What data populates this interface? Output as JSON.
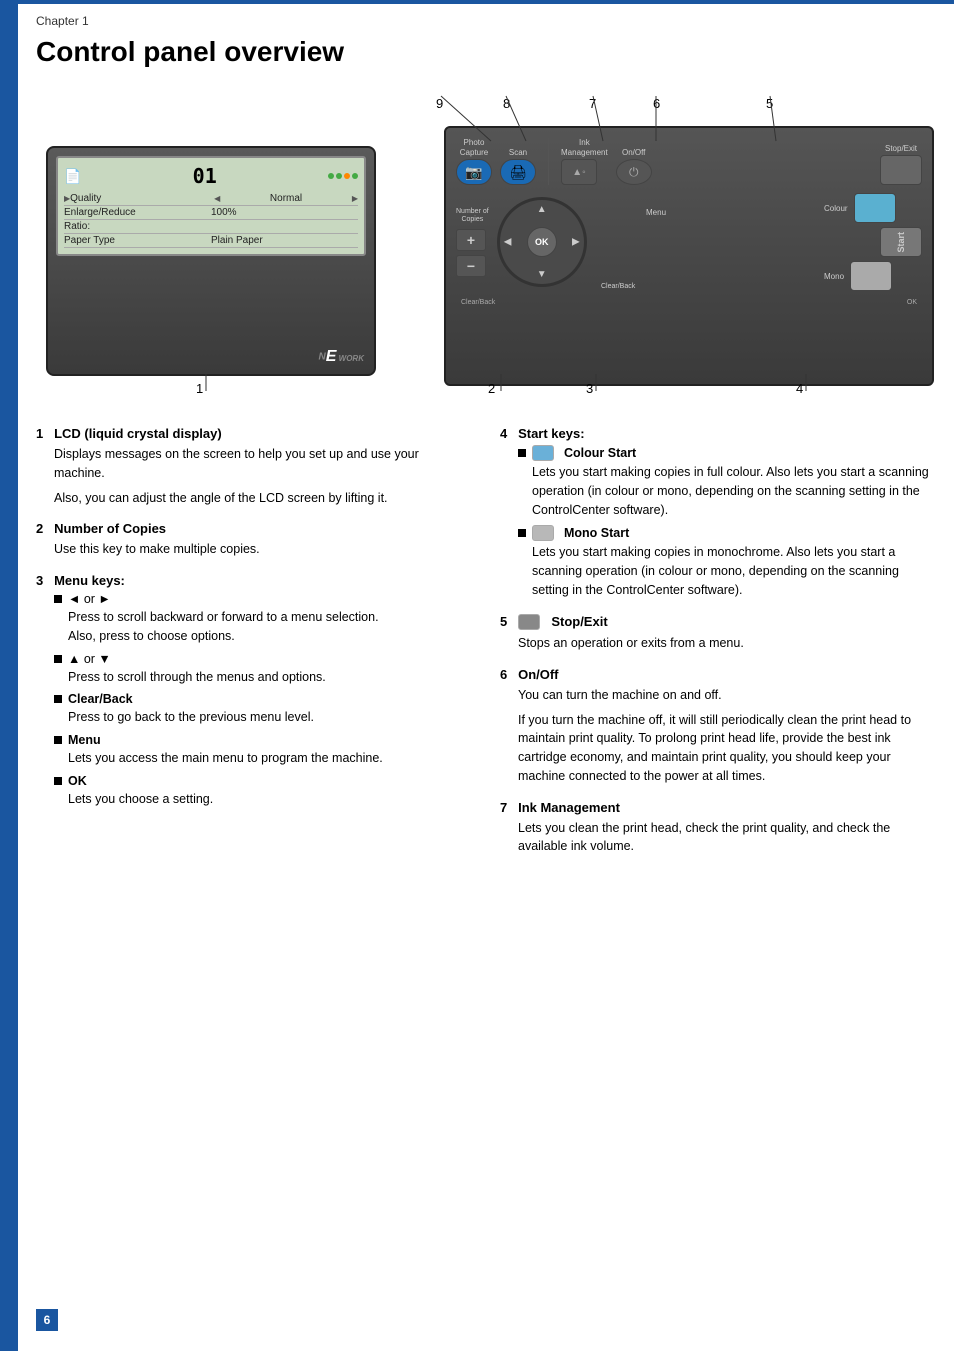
{
  "page": {
    "chapter_label": "Chapter 1",
    "title": "Control panel overview",
    "page_number": "6"
  },
  "diagram": {
    "number_labels": [
      {
        "id": "num9",
        "text": "9"
      },
      {
        "id": "num8",
        "text": "8"
      },
      {
        "id": "num7",
        "text": "7"
      },
      {
        "id": "num6",
        "text": "6"
      },
      {
        "id": "num5",
        "text": "5"
      },
      {
        "id": "num1",
        "text": "1"
      },
      {
        "id": "num2",
        "text": "2"
      },
      {
        "id": "num3",
        "text": "3"
      },
      {
        "id": "num4",
        "text": "4"
      }
    ],
    "lcd": {
      "number": "01",
      "rows": [
        {
          "label": "Quality",
          "value": "Normal",
          "has_arrows": true
        },
        {
          "label": "Enlarge/Reduce",
          "value": "100%"
        },
        {
          "label": "Ratio:",
          "value": ""
        },
        {
          "label": "Paper Type",
          "value": "Plain Paper"
        }
      ],
      "network_text": "NE WORK"
    },
    "ctrl_buttons": [
      {
        "label": "Photo\nCapture",
        "type": "dark"
      },
      {
        "label": "Scan",
        "type": "dark"
      },
      {
        "label": "Ink\nManagement",
        "type": "dark"
      },
      {
        "label": "On/Off",
        "type": "dark"
      }
    ]
  },
  "items": [
    {
      "number": "1",
      "title": "LCD (liquid crystal display)",
      "paragraphs": [
        "Displays messages on the screen to help you set up and use your machine.",
        "Also, you can adjust the angle of the LCD screen by lifting it."
      ],
      "sub_items": []
    },
    {
      "number": "2",
      "title": "Number of Copies",
      "paragraphs": [
        "Use this key to make multiple copies."
      ],
      "sub_items": []
    },
    {
      "number": "3",
      "title": "Menu keys:",
      "paragraphs": [],
      "sub_items": [
        {
          "label": "◄ or ►",
          "texts": [
            "Press to scroll backward or forward to a menu selection.",
            "Also, press to choose options."
          ]
        },
        {
          "label": "▲ or ▼",
          "texts": [
            "Press to scroll through the menus and options."
          ]
        },
        {
          "label": "Clear/Back",
          "texts": [
            "Press to go back to the previous menu level."
          ]
        },
        {
          "label": "Menu",
          "texts": [
            "Lets you access the main menu to program the machine."
          ]
        },
        {
          "label": "OK",
          "texts": [
            "Lets you choose a setting."
          ]
        }
      ]
    },
    {
      "number": "4",
      "title": "Start keys:",
      "paragraphs": [],
      "sub_items": [
        {
          "label": "Colour Start",
          "key_type": "colour",
          "texts": [
            "Lets you start making copies in full colour. Also lets you start a scanning operation (in colour or mono, depending on the scanning setting in the ControlCenter software)."
          ]
        },
        {
          "label": "Mono Start",
          "key_type": "mono",
          "texts": [
            "Lets you start making copies in monochrome. Also lets you start a scanning operation (in colour or mono, depending on the scanning setting in the ControlCenter software)."
          ]
        }
      ]
    },
    {
      "number": "5",
      "title": "Stop/Exit",
      "key_type": "stop",
      "paragraphs": [
        "Stops an operation or exits from a menu."
      ],
      "sub_items": []
    },
    {
      "number": "6",
      "title": "On/Off",
      "paragraphs": [
        "You can turn the machine on and off.",
        "If you turn the machine off, it will still periodically clean the print head to maintain print quality. To prolong print head life, provide the best ink cartridge economy, and maintain print quality, you should keep your machine connected to the power at all times."
      ],
      "sub_items": []
    },
    {
      "number": "7",
      "title": "Ink Management",
      "paragraphs": [
        "Lets you clean the print head, check the print quality, and check the available ink volume."
      ],
      "sub_items": []
    }
  ]
}
